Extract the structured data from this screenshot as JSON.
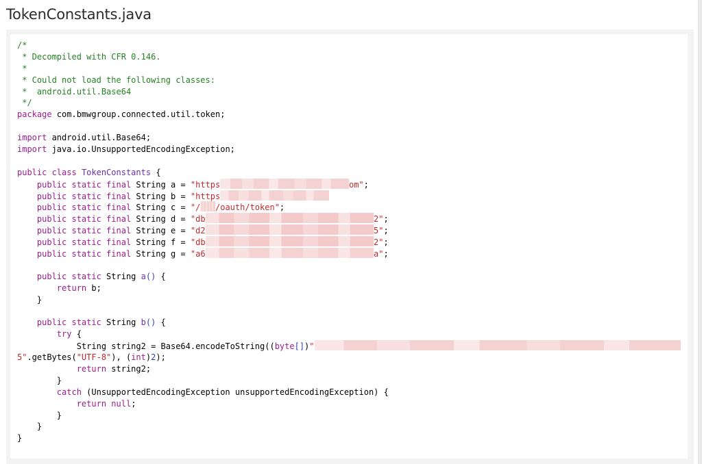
{
  "file": {
    "title": "TokenConstants.java"
  },
  "code": {
    "lines": [
      [
        {
          "t": "/*",
          "c": "comment"
        }
      ],
      [
        {
          "t": " * Decompiled with CFR 0.146.",
          "c": "comment"
        }
      ],
      [
        {
          "t": " *",
          "c": "comment"
        }
      ],
      [
        {
          "t": " * Could not load the following classes:",
          "c": "comment"
        }
      ],
      [
        {
          "t": " *  android.util.Base64",
          "c": "comment"
        }
      ],
      [
        {
          "t": " */",
          "c": "comment"
        }
      ],
      [
        {
          "t": "package",
          "c": "kw"
        },
        {
          "t": " com.bmwgroup.connected.util.token;"
        }
      ],
      [],
      [
        {
          "t": "import",
          "c": "kw"
        },
        {
          "t": " android.util.Base64;"
        }
      ],
      [
        {
          "t": "import",
          "c": "kw"
        },
        {
          "t": " java.io.UnsupportedEncodingException;"
        }
      ],
      [],
      [
        {
          "t": "public class",
          "c": "kw"
        },
        {
          "t": " "
        },
        {
          "t": "TokenConstants",
          "c": "cls"
        },
        {
          "t": " {"
        }
      ],
      [
        {
          "t": "    "
        },
        {
          "t": "public static final",
          "c": "kw"
        },
        {
          "t": " String a = "
        },
        {
          "t": "\"https",
          "c": "str"
        },
        {
          "r": 26
        },
        {
          "t": "om\"",
          "c": "str"
        },
        {
          "t": ";"
        }
      ],
      [
        {
          "t": "    "
        },
        {
          "t": "public static final",
          "c": "kw"
        },
        {
          "t": " String b = "
        },
        {
          "t": "\"https",
          "c": "str"
        },
        {
          "r": 22
        }
      ],
      [
        {
          "t": "    "
        },
        {
          "t": "public static final",
          "c": "kw"
        },
        {
          "t": " String c = "
        },
        {
          "t": "\"/",
          "c": "str"
        },
        {
          "r": 3
        },
        {
          "t": "/oauth/token\"",
          "c": "str"
        },
        {
          "t": ";"
        }
      ],
      [
        {
          "t": "    "
        },
        {
          "t": "public static final",
          "c": "kw"
        },
        {
          "t": " String d = "
        },
        {
          "t": "\"db",
          "c": "str"
        },
        {
          "r": 34,
          "tall": true
        },
        {
          "t": "2\"",
          "c": "str"
        },
        {
          "t": ";"
        }
      ],
      [
        {
          "t": "    "
        },
        {
          "t": "public static final",
          "c": "kw"
        },
        {
          "t": " String e = "
        },
        {
          "t": "\"d2",
          "c": "str"
        },
        {
          "r": 34,
          "tall": true
        },
        {
          "t": "5\"",
          "c": "str"
        },
        {
          "t": ";"
        }
      ],
      [
        {
          "t": "    "
        },
        {
          "t": "public static final",
          "c": "kw"
        },
        {
          "t": " String f = "
        },
        {
          "t": "\"db",
          "c": "str"
        },
        {
          "r": 34,
          "tall": true
        },
        {
          "t": "2\"",
          "c": "str"
        },
        {
          "t": ";"
        }
      ],
      [
        {
          "t": "    "
        },
        {
          "t": "public static final",
          "c": "kw"
        },
        {
          "t": " String g = "
        },
        {
          "t": "\"a6",
          "c": "str"
        },
        {
          "r": 34
        },
        {
          "t": "a\"",
          "c": "str"
        },
        {
          "t": ";"
        }
      ],
      [],
      [
        {
          "t": "    "
        },
        {
          "t": "public static",
          "c": "kw"
        },
        {
          "t": " String "
        },
        {
          "t": "a",
          "c": "cls"
        },
        {
          "t": "()",
          "c": "paren"
        },
        {
          "t": " {"
        }
      ],
      [
        {
          "t": "        "
        },
        {
          "t": "return",
          "c": "kw"
        },
        {
          "t": " b;"
        }
      ],
      [
        {
          "t": "    }"
        }
      ],
      [],
      [
        {
          "t": "    "
        },
        {
          "t": "public static",
          "c": "kw"
        },
        {
          "t": " String "
        },
        {
          "t": "b",
          "c": "cls"
        },
        {
          "t": "()",
          "c": "paren"
        },
        {
          "t": " {"
        }
      ],
      [
        {
          "t": "        "
        },
        {
          "t": "try",
          "c": "kw"
        },
        {
          "t": " {"
        }
      ],
      [
        {
          "t": "            String string2 = Base64.encodeToString(("
        },
        {
          "t": "byte",
          "c": "kw"
        },
        {
          "t": "[]",
          "c": "paren"
        },
        {
          "t": ")"
        },
        {
          "t": "\"",
          "c": "str"
        },
        {
          "r": 74
        }
      ],
      [
        {
          "t": "5\"",
          "c": "str"
        },
        {
          "t": ".getBytes("
        },
        {
          "t": "\"UTF-8\"",
          "c": "str"
        },
        {
          "t": "), ("
        },
        {
          "t": "int",
          "c": "kw"
        },
        {
          "t": ")"
        },
        {
          "t": "2",
          "c": "paren"
        },
        {
          "t": ");"
        }
      ],
      [
        {
          "t": "            "
        },
        {
          "t": "return",
          "c": "kw"
        },
        {
          "t": " string2;"
        }
      ],
      [
        {
          "t": "        }"
        }
      ],
      [
        {
          "t": "        "
        },
        {
          "t": "catch",
          "c": "kw"
        },
        {
          "t": " (UnsupportedEncodingException unsupportedEncodingException) {"
        }
      ],
      [
        {
          "t": "            "
        },
        {
          "t": "return null",
          "c": "kw"
        },
        {
          "t": ";"
        }
      ],
      [
        {
          "t": "        }"
        }
      ],
      [
        {
          "t": "    }"
        }
      ],
      [
        {
          "t": "}"
        }
      ]
    ]
  },
  "colors": {
    "comment": "#238323",
    "keyword": "#9b1c8f",
    "string": "#c0282d",
    "identifier": "#6b2fae",
    "redaction": "#f5d2d2"
  }
}
